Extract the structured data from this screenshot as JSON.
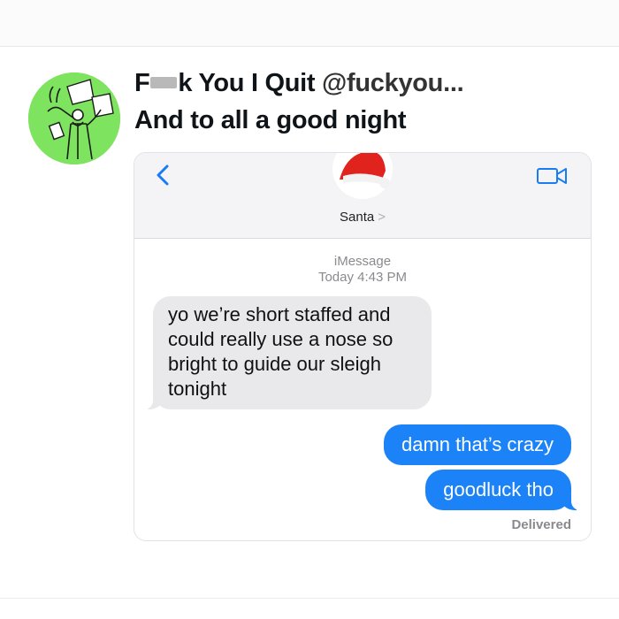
{
  "tweet": {
    "name_start": "F",
    "name_end": "k You I Quit",
    "handle": "@fuckyou...",
    "text": "And to all a good night"
  },
  "screenshot": {
    "contact": {
      "name": "Santa",
      "chevron": ">"
    },
    "meta": {
      "service": "iMessage",
      "time": "Today 4:43 PM"
    },
    "messages": [
      {
        "direction": "incoming",
        "text": "yo we’re short staffed  and could really use a nose so bright to guide our sleigh tonight"
      },
      {
        "direction": "outgoing",
        "text": "damn that’s crazy"
      },
      {
        "direction": "outgoing",
        "text": "goodluck tho"
      }
    ],
    "status": "Delivered"
  },
  "colors": {
    "avatar_bg": "#7ee35f",
    "imessage_blue": "#1b82f7",
    "incoming_bubble": "#e9e9eb",
    "ios_accent": "#1a7cf5"
  },
  "icons": {
    "back": "chevron-left-icon",
    "video": "video-camera-icon",
    "contact": "santa-hat-icon"
  }
}
